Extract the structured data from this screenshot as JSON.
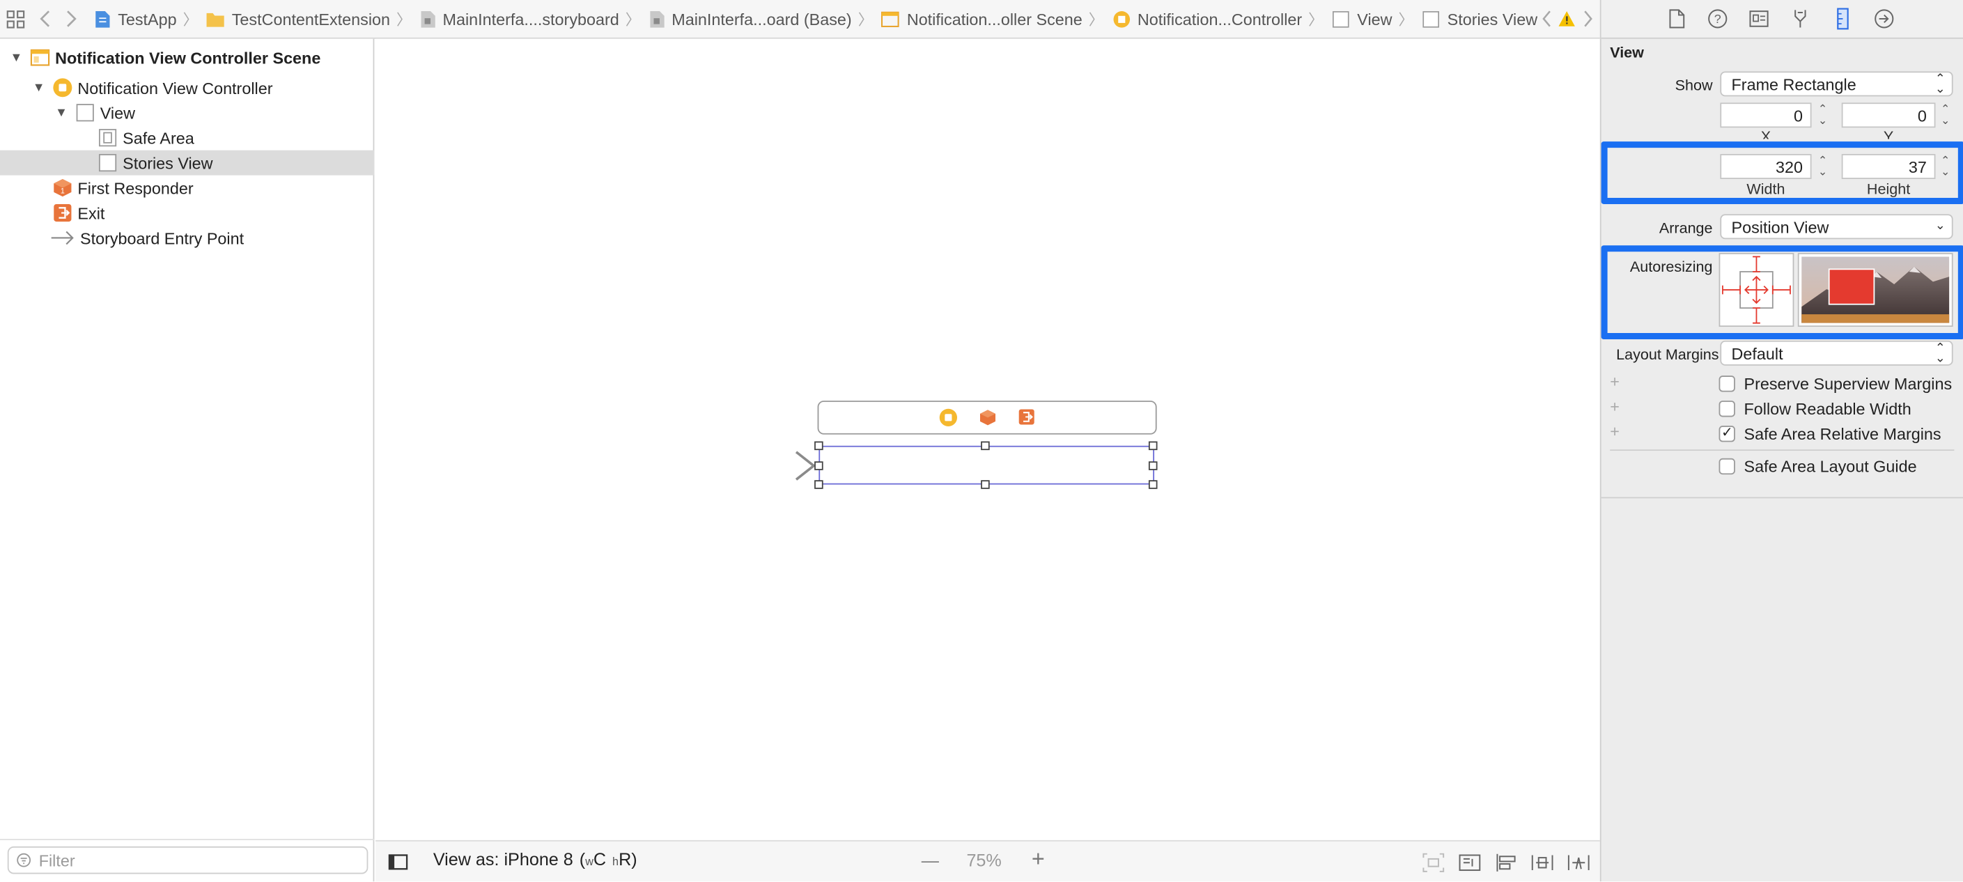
{
  "breadcrumbs": [
    {
      "label": "TestApp",
      "icon": "project-icon"
    },
    {
      "label": "TestContentExtension",
      "icon": "folder-icon"
    },
    {
      "label": "MainInterfa....storyboard",
      "icon": "storyboard-icon"
    },
    {
      "label": "MainInterfa...oard (Base)",
      "icon": "storyboard-icon"
    },
    {
      "label": "Notification...oller Scene",
      "icon": "scene-icon"
    },
    {
      "label": "Notification...Controller",
      "icon": "view-controller-icon"
    },
    {
      "label": "View",
      "icon": "view-icon"
    },
    {
      "label": "Stories View",
      "icon": "view-icon"
    }
  ],
  "outline": {
    "scene": "Notification View Controller Scene",
    "controller": "Notification View Controller",
    "view": "View",
    "safe_area": "Safe Area",
    "stories_view": "Stories View",
    "first_responder": "First Responder",
    "exit": "Exit",
    "entry_point": "Storyboard Entry Point"
  },
  "filter": {
    "placeholder": "Filter"
  },
  "canvas_bar": {
    "view_as": "View as: iPhone 8",
    "size_class_w": "w",
    "size_class_w_val": "C",
    "size_class_h": "h",
    "size_class_h_val": "R",
    "open_paren": "(",
    "close_paren": ")",
    "zoom": "75%",
    "zoom_out": "—",
    "zoom_in": "+"
  },
  "inspector": {
    "section_title": "View",
    "show_label": "Show",
    "show_value": "Frame Rectangle",
    "x_value": "0",
    "y_value": "0",
    "x_label": "X",
    "y_label": "Y",
    "width_value": "320",
    "height_value": "37",
    "width_label": "Width",
    "height_label": "Height",
    "arrange_label": "Arrange",
    "arrange_value": "Position View",
    "autoresizing_label": "Autoresizing",
    "layout_margins_label": "Layout Margins",
    "layout_margins_value": "Default",
    "checkboxes": [
      {
        "label": "Preserve Superview Margins",
        "checked": false
      },
      {
        "label": "Follow Readable Width",
        "checked": false
      },
      {
        "label": "Safe Area Relative Margins",
        "checked": true
      },
      {
        "label": "Safe Area Layout Guide",
        "checked": false
      }
    ]
  },
  "colors": {
    "highlight": "#1a6ff2",
    "selection": "#6b6bd6",
    "accent_yellow": "#f5b82e",
    "accent_orange": "#e8743b",
    "autoresize_red": "#e43a2f"
  }
}
